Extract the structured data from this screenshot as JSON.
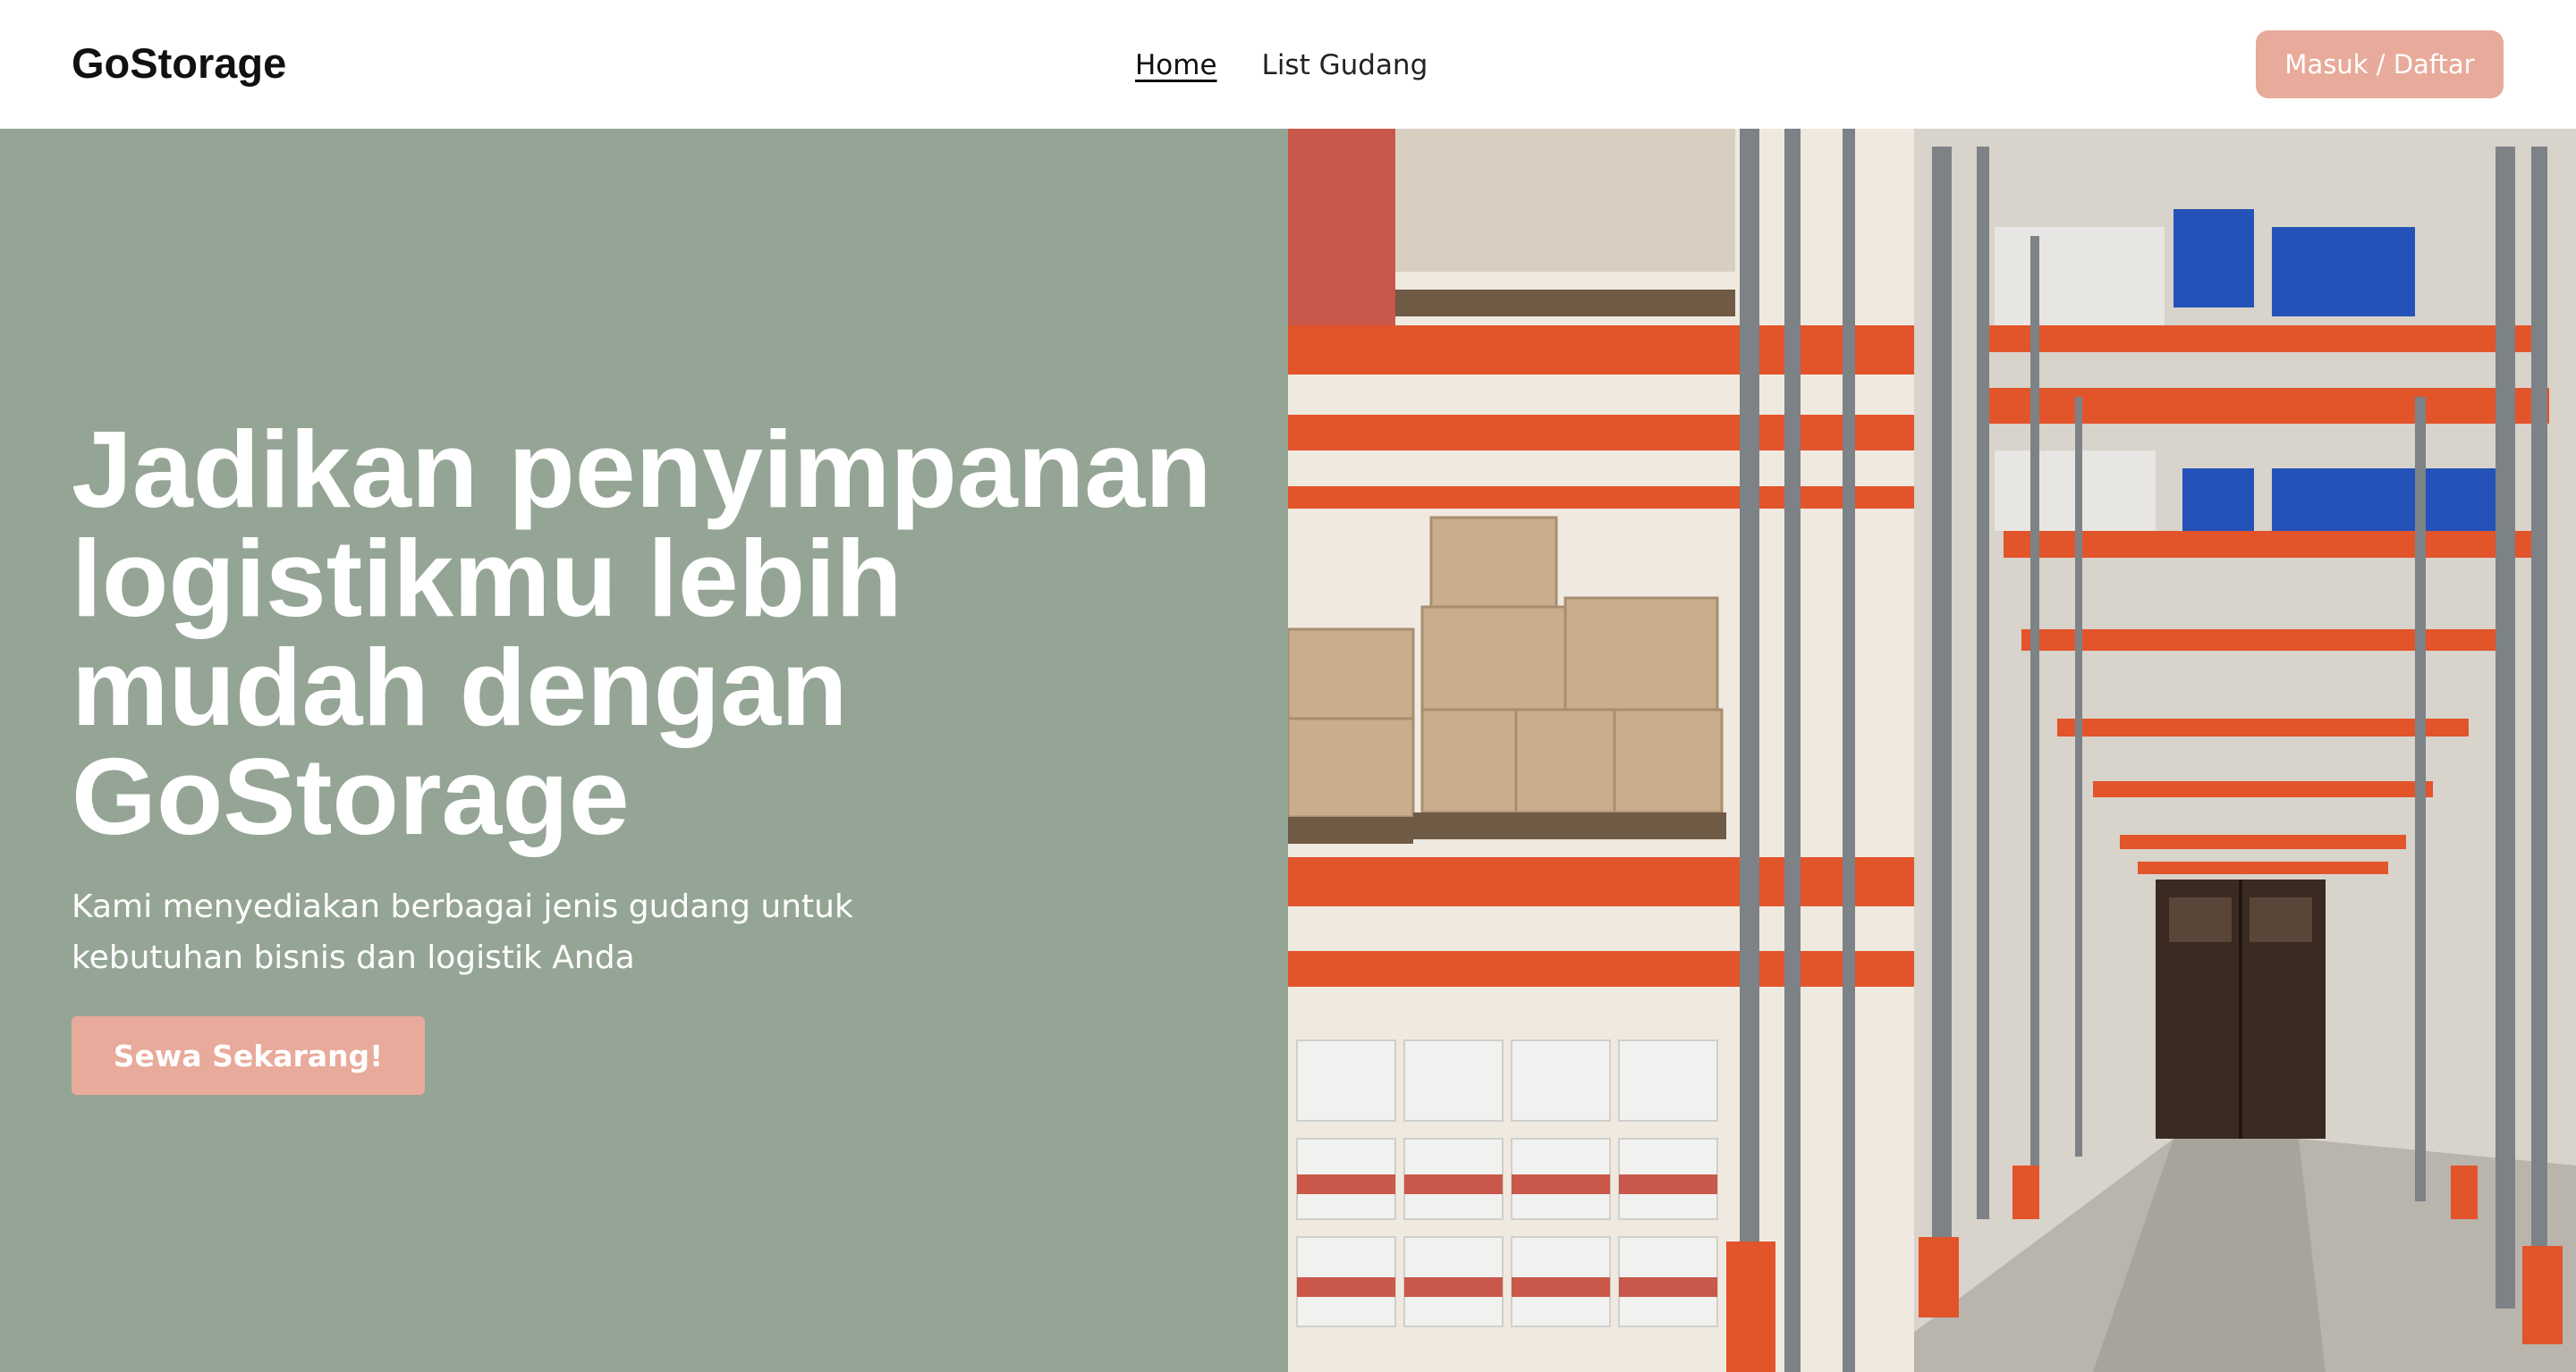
{
  "navbar": {
    "brand": "GoStorage",
    "links": [
      {
        "label": "Home",
        "active": true
      },
      {
        "label": "List Gudang",
        "active": false
      }
    ],
    "login_label": "Masuk / Daftar"
  },
  "hero": {
    "title": "Jadikan penyimpanan logistikmu lebih mudah dengan GoStorage",
    "subtitle": "Kami menyediakan berbagai jenis gudang untuk kebutuhan bisnis dan logistik Anda",
    "cta_label": "Sewa Sekarang!",
    "image_icon": "warehouse-photo"
  },
  "colors": {
    "accent": "#e8aa9a",
    "hero_bg": "#95a595",
    "rack_orange": "#e2542a",
    "rack_steel": "#7d8287",
    "barrel_blue": "#2452b8"
  }
}
